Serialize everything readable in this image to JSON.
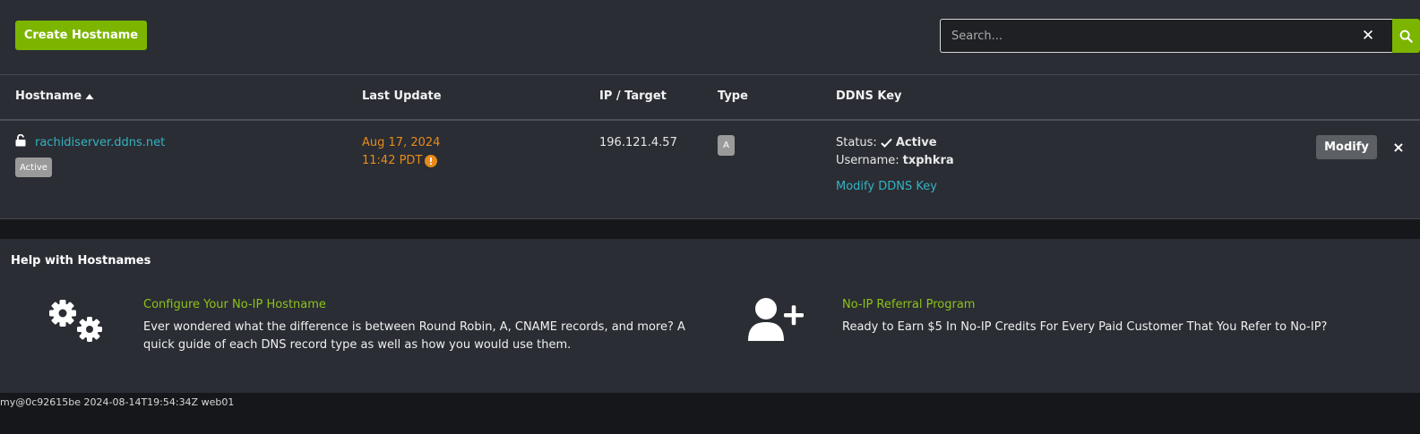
{
  "toolbar": {
    "create_label": "Create Hostname",
    "search_placeholder": "Search...",
    "search_value": "",
    "clear_glyph": "✕"
  },
  "table": {
    "columns": [
      "Hostname",
      "Last Update",
      "IP / Target",
      "Type",
      "DDNS Key"
    ],
    "sort": {
      "column": "Hostname",
      "direction": "ascending"
    },
    "rows": [
      {
        "hostname": "rachidiserver.ddns.net",
        "hostname_badge": "Active",
        "update_date": "Aug 17, 2024",
        "update_time": "11:42 PDT",
        "ip": "196.121.4.57",
        "type": "A",
        "status_label": "Status:",
        "status_value": "Active",
        "username_label": "Username:",
        "username_value": "txphkra",
        "modify_ddns_link": "Modify DDNS Key",
        "modify_label": "Modify",
        "delete_glyph": "×"
      }
    ]
  },
  "help": {
    "title": "Help with Hostnames",
    "items": [
      {
        "icon": "gears-icon",
        "heading": "Configure Your No-IP Hostname",
        "text_line1": "Ever wondered what the difference is between Round Robin, A, CNAME records, and more? A",
        "text_line2": "quick guide of each DNS record type as well as how you would use them."
      },
      {
        "icon": "user-plus-icon",
        "heading": "No-IP Referral Program",
        "text_line1": "Ready to Earn $5 In No-IP Credits For Every Paid Customer That You Refer to No-IP?"
      }
    ]
  },
  "footer": {
    "text": "my@0c92615be 2024-08-14T19:54:34Z web01"
  },
  "colors": {
    "accent_green": "#7cb500",
    "link_teal": "#33b3c4",
    "warning_orange": "#e88a1a",
    "panel_bg": "#2a2d33",
    "page_bg": "#15171a"
  }
}
